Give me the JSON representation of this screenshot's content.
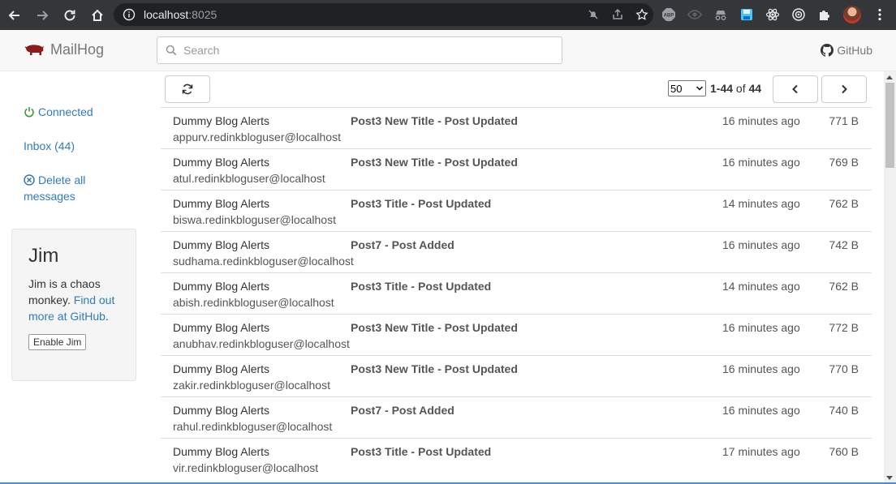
{
  "browser": {
    "url_host": "localhost",
    "url_port": ":8025"
  },
  "app": {
    "brand": "MailHog",
    "search_placeholder": "Search",
    "github_label": "GitHub"
  },
  "sidebar": {
    "connected": "Connected",
    "inbox": "Inbox (44)",
    "delete_all": "Delete all messages",
    "jim": {
      "title": "Jim",
      "desc": "Jim is a chaos monkey.",
      "link": "Find out more at GitHub",
      "link_suffix": ".",
      "button": "Enable Jim"
    }
  },
  "toolbar": {
    "per_page": "50",
    "range": "1-44",
    "of": "of",
    "total": "44"
  },
  "messages": [
    {
      "from": "Dummy Blog Alerts",
      "to": "appurv.redinkbloguser@localhost",
      "subject": "Post3 New Title - Post Updated",
      "time": "16 minutes ago",
      "size": "771 B"
    },
    {
      "from": "Dummy Blog Alerts",
      "to": "atul.redinkbloguser@localhost",
      "subject": "Post3 New Title - Post Updated",
      "time": "16 minutes ago",
      "size": "769 B"
    },
    {
      "from": "Dummy Blog Alerts",
      "to": "biswa.redinkbloguser@localhost",
      "subject": "Post3 Title - Post Updated",
      "time": "14 minutes ago",
      "size": "762 B"
    },
    {
      "from": "Dummy Blog Alerts",
      "to": "sudhama.redinkbloguser@localhost",
      "subject": "Post7 - Post Added",
      "time": "16 minutes ago",
      "size": "742 B"
    },
    {
      "from": "Dummy Blog Alerts",
      "to": "abish.redinkbloguser@localhost",
      "subject": "Post3 Title - Post Updated",
      "time": "14 minutes ago",
      "size": "762 B"
    },
    {
      "from": "Dummy Blog Alerts",
      "to": "anubhav.redinkbloguser@localhost",
      "subject": "Post3 New Title - Post Updated",
      "time": "16 minutes ago",
      "size": "772 B"
    },
    {
      "from": "Dummy Blog Alerts",
      "to": "zakir.redinkbloguser@localhost",
      "subject": "Post3 New Title - Post Updated",
      "time": "16 minutes ago",
      "size": "770 B"
    },
    {
      "from": "Dummy Blog Alerts",
      "to": "rahul.redinkbloguser@localhost",
      "subject": "Post7 - Post Added",
      "time": "16 minutes ago",
      "size": "740 B"
    },
    {
      "from": "Dummy Blog Alerts",
      "to": "vir.redinkbloguser@localhost",
      "subject": "Post3 Title - Post Updated",
      "time": "17 minutes ago",
      "size": "760 B"
    }
  ]
}
